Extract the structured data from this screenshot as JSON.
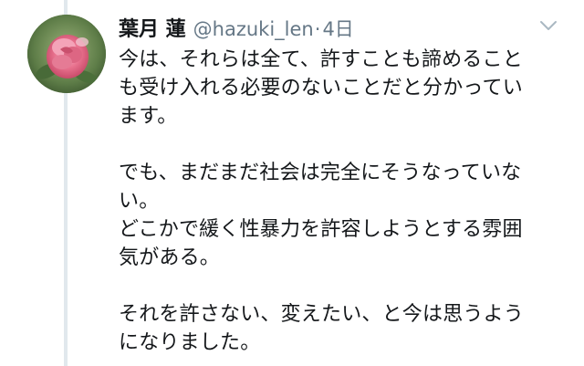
{
  "tweet": {
    "display_name": "葉月 蓮",
    "handle": "@hazuki_len",
    "separator": "·",
    "time": "4日",
    "text": "今は、それらは全て、許すことも諦めること\nも受け入れる必要のないことだと分かってい\nます。\n\nでも、まだまだ社会は完全にそうなっていな\nい。\nどこかで緩く性暴力を許容しようとする雰囲\n気がある。\n\nそれを許さない、変えたい、と今は思うよう\nになりました。"
  },
  "icons": {
    "avatar": "rose-photo-avatar",
    "menu": "chevron-down-icon"
  },
  "colors": {
    "text_primary": "#14171a",
    "text_secondary": "#657786",
    "thread_line": "#e1e8ed",
    "caret": "#aab8c2"
  }
}
